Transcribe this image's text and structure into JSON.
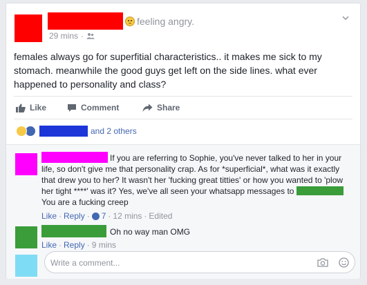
{
  "colors": {
    "author_avatar": "#ff0000",
    "author_name_redaction": "#ff0000",
    "reactor_redaction": "#1c36d8",
    "commenter1_avatar": "#ff00ff",
    "commenter1_name_redaction": "#ff00ff",
    "mention_redaction": "#3a9d3a",
    "commenter2_avatar": "#3a9d3a",
    "commenter2_name_redaction": "#3a9d3a",
    "viewer_avatar": "#7fdcf5",
    "link_blue": "#4267b2",
    "meta_gray": "#90949c"
  },
  "post": {
    "feeling": "feeling angry.",
    "feeling_icon": "angry-face-icon",
    "time": "29 mins",
    "audience_icon": "friends-icon",
    "menu_icon": "chevron-down-icon",
    "text": "females always go for superfitial characteristics.. it makes me sick to my stomach. meanwhile the good guys get left on the side lines. what ever happened to personality and class?"
  },
  "actions": {
    "like": "Like",
    "comment": "Comment",
    "share": "Share"
  },
  "reactions": {
    "icons": [
      "haha-icon",
      "like-icon"
    ],
    "others_text": "and 2 others"
  },
  "comments": [
    {
      "text_main": "If you are referring to Sophie, you've never talked to her in your life, so don't give me that personality crap. As for *superficial*, what was it exactly that drew you to her? It wasn't her 'fucking great titties' or how you wanted to 'plow her tight ****' was it? Yes, we've all seen your whatsapp messages to",
      "text_after_mention": "You are a fucking creep",
      "like": "Like",
      "reply": "Reply",
      "like_count": "7",
      "time": "12 mins",
      "edited": "Edited"
    },
    {
      "text_main": "Oh no way man OMG",
      "like": "Like",
      "reply": "Reply",
      "time": "9 mins"
    }
  ],
  "composer": {
    "placeholder": "Write a comment...",
    "icons": [
      "camera-icon",
      "emoji-icon"
    ]
  }
}
